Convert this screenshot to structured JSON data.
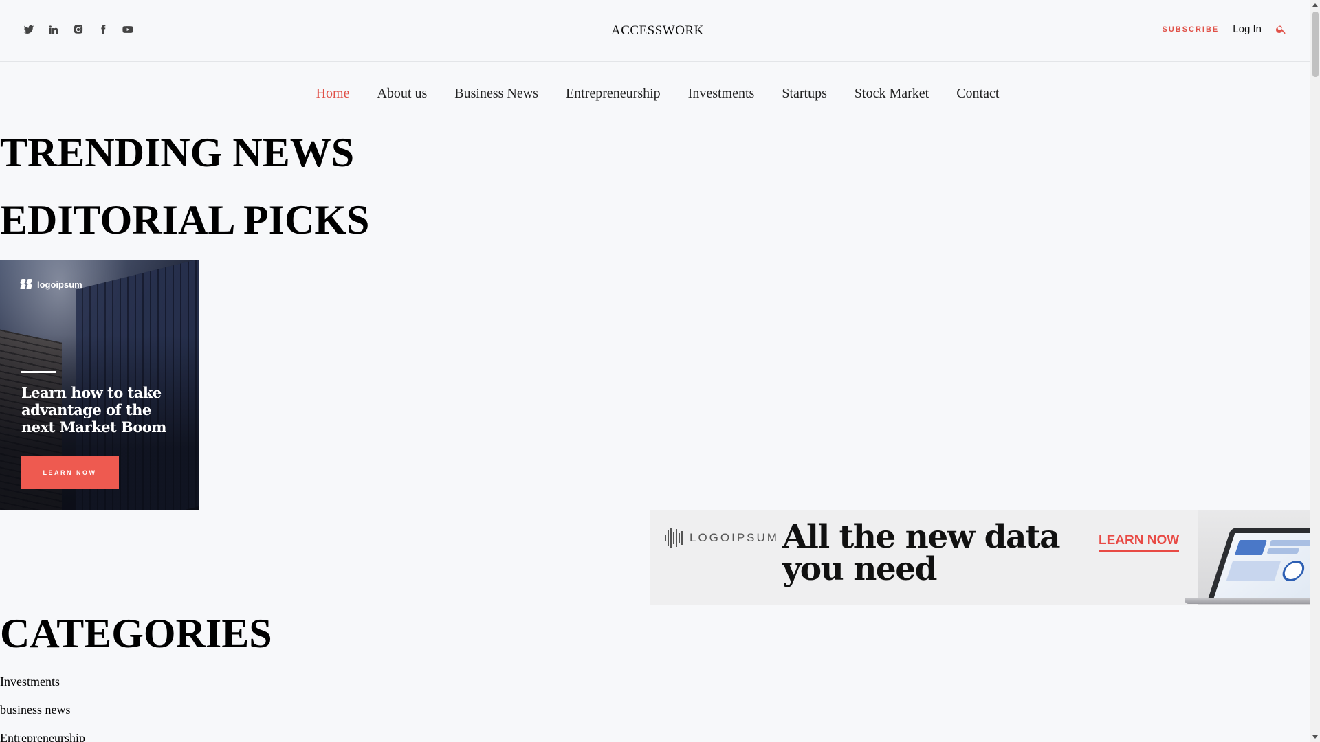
{
  "header": {
    "logo": "ACCESSWORK",
    "social_icons": [
      "twitter-icon",
      "linkedin-icon",
      "instagram-icon",
      "facebook-icon",
      "youtube-icon"
    ],
    "subscribe_label": "SUBSCRIBE",
    "login_label": "Log In",
    "accent_color": "#e05047"
  },
  "nav": {
    "items": [
      {
        "label": "Home",
        "active": true
      },
      {
        "label": "About us"
      },
      {
        "label": "Business News"
      },
      {
        "label": "Entrepreneurship"
      },
      {
        "label": "Investments"
      },
      {
        "label": "Startups"
      },
      {
        "label": "Stock Market"
      },
      {
        "label": "Contact"
      }
    ]
  },
  "sections": {
    "trending": "TRENDING NEWS",
    "editorial": "EDITORIAL PICKS",
    "categories": "CATEGORIES"
  },
  "ad_square": {
    "brand": "logoipsum",
    "headline": "Learn how to take advantage of the next Market Boom",
    "cta": "LEARN NOW",
    "cta_color": "#ee5a50"
  },
  "ad_banner": {
    "brand": "LOGOIPSUM",
    "headline": "All the new data you need",
    "cta": "LEARN NOW",
    "cta_color": "#e84a45"
  },
  "categories": [
    "Investments",
    "business news",
    "Entrepreneurship"
  ]
}
